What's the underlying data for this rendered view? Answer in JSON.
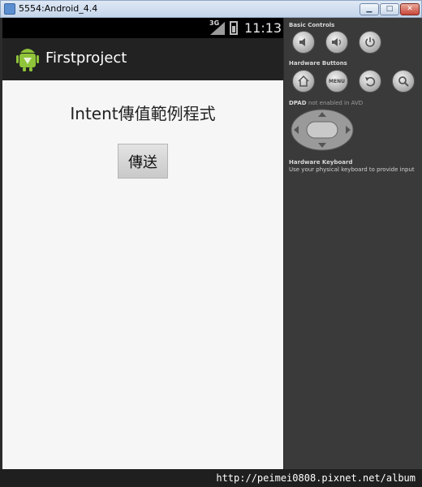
{
  "window": {
    "title": "5554:Android_4.4",
    "min_label": "▁",
    "max_label": "□",
    "close_label": "✕"
  },
  "statusbar": {
    "network": "3G",
    "time": "11:13"
  },
  "actionbar": {
    "title": "Firstproject",
    "icon": "android-app-icon"
  },
  "content": {
    "heading": "Intent傳值範例程式",
    "button_label": "傳送"
  },
  "controls": {
    "basic_label": "Basic Controls",
    "hardware_label": "Hardware Buttons",
    "menu_label": "MENU",
    "dpad_label": "DPAD",
    "dpad_note": "not enabled in AVD",
    "keyboard_label": "Hardware Keyboard",
    "keyboard_hint": "Use your physical keyboard to provide input"
  },
  "footer": {
    "url": "http://peimei0808.pixnet.net/album"
  },
  "colors": {
    "actionbar": "#222222",
    "screen_bg": "#f6f6f6",
    "panel_bg": "#3a3a3a"
  }
}
